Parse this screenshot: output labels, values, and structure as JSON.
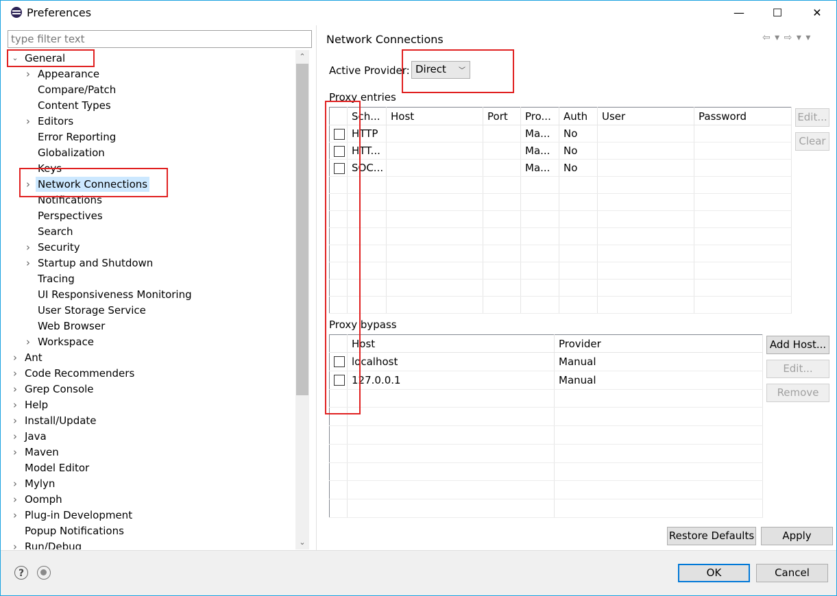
{
  "window": {
    "title": "Preferences",
    "minimize": "—",
    "maximize": "☐",
    "close": "✕"
  },
  "filter": {
    "placeholder": "type filter text"
  },
  "tree": [
    {
      "label": "General",
      "level": 0,
      "expander": "expanded"
    },
    {
      "label": "Appearance",
      "level": 1,
      "expander": "collapsed"
    },
    {
      "label": "Compare/Patch",
      "level": 1,
      "expander": "none"
    },
    {
      "label": "Content Types",
      "level": 1,
      "expander": "none"
    },
    {
      "label": "Editors",
      "level": 1,
      "expander": "collapsed"
    },
    {
      "label": "Error Reporting",
      "level": 1,
      "expander": "none"
    },
    {
      "label": "Globalization",
      "level": 1,
      "expander": "none"
    },
    {
      "label": "Keys",
      "level": 1,
      "expander": "none"
    },
    {
      "label": "Network Connections",
      "level": 1,
      "expander": "collapsed",
      "selected": true
    },
    {
      "label": "Notifications",
      "level": 1,
      "expander": "none"
    },
    {
      "label": "Perspectives",
      "level": 1,
      "expander": "none"
    },
    {
      "label": "Search",
      "level": 1,
      "expander": "none"
    },
    {
      "label": "Security",
      "level": 1,
      "expander": "collapsed"
    },
    {
      "label": "Startup and Shutdown",
      "level": 1,
      "expander": "collapsed"
    },
    {
      "label": "Tracing",
      "level": 1,
      "expander": "none"
    },
    {
      "label": "UI Responsiveness Monitoring",
      "level": 1,
      "expander": "none"
    },
    {
      "label": "User Storage Service",
      "level": 1,
      "expander": "none"
    },
    {
      "label": "Web Browser",
      "level": 1,
      "expander": "none"
    },
    {
      "label": "Workspace",
      "level": 1,
      "expander": "collapsed"
    },
    {
      "label": "Ant",
      "level": 0,
      "expander": "collapsed"
    },
    {
      "label": "Code Recommenders",
      "level": 0,
      "expander": "collapsed"
    },
    {
      "label": "Grep Console",
      "level": 0,
      "expander": "collapsed"
    },
    {
      "label": "Help",
      "level": 0,
      "expander": "collapsed"
    },
    {
      "label": "Install/Update",
      "level": 0,
      "expander": "collapsed"
    },
    {
      "label": "Java",
      "level": 0,
      "expander": "collapsed"
    },
    {
      "label": "Maven",
      "level": 0,
      "expander": "collapsed"
    },
    {
      "label": "Model Editor",
      "level": 0,
      "expander": "none"
    },
    {
      "label": "Mylyn",
      "level": 0,
      "expander": "collapsed"
    },
    {
      "label": "Oomph",
      "level": 0,
      "expander": "collapsed"
    },
    {
      "label": "Plug-in Development",
      "level": 0,
      "expander": "collapsed"
    },
    {
      "label": "Popup Notifications",
      "level": 0,
      "expander": "none"
    },
    {
      "label": "Run/Debug",
      "level": 0,
      "expander": "collapsed"
    }
  ],
  "page": {
    "title": "Network Connections",
    "nav_arrows": "⇦ ▾  ⇨ ▾  ▾",
    "active_provider_label": "Active Provider:",
    "active_provider_value": "Direct",
    "proxy_entries_label": "Proxy entries",
    "proxy_columns": [
      "Sch...",
      "Host",
      "Port",
      "Pro...",
      "Auth",
      "User",
      "Password"
    ],
    "proxy_rows": [
      [
        "HTTP",
        "",
        "",
        "Ma...",
        "No",
        "",
        ""
      ],
      [
        "HTT...",
        "",
        "",
        "Ma...",
        "No",
        "",
        ""
      ],
      [
        "SOC...",
        "",
        "",
        "Ma...",
        "No",
        "",
        ""
      ]
    ],
    "proxy_buttons": {
      "edit": "Edit...",
      "clear": "Clear"
    },
    "bypass_label": "Proxy bypass",
    "bypass_columns": [
      "Host",
      "Provider"
    ],
    "bypass_rows": [
      [
        "localhost",
        "Manual"
      ],
      [
        "127.0.0.1",
        "Manual"
      ]
    ],
    "bypass_buttons": {
      "add": "Add Host...",
      "edit": "Edit...",
      "remove": "Remove"
    },
    "restore_defaults": "Restore Defaults",
    "apply": "Apply"
  },
  "dialog_buttons": {
    "ok": "OK",
    "cancel": "Cancel"
  },
  "colors": {
    "selection": "#cce8ff",
    "highlight_box": "#e02020",
    "default_button_border": "#0078d7"
  }
}
